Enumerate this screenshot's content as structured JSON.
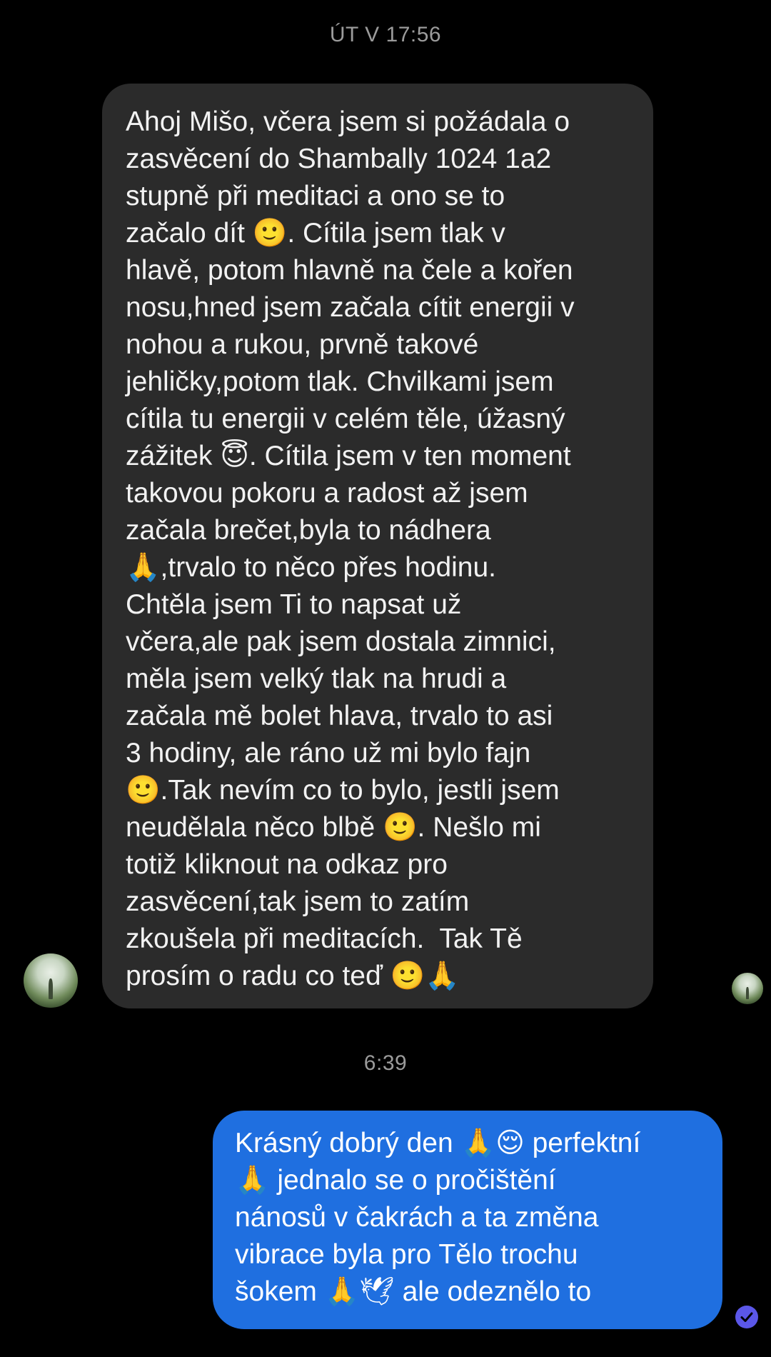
{
  "timestamps": {
    "first": "ÚT V 17:56",
    "second": "6:39"
  },
  "messages": {
    "incoming": {
      "text": "Ahoj Mišo, včera jsem si požádala o\nzasvěcení do Shambally 1024 1a2\nstupně při meditaci a ono se to\nzačalo dít 🙂. Cítila jsem tlak v\nhlavě, potom hlavně na čele a kořen\nnosu,hned jsem začala cítit energii v\nnohou a rukou, prvně takové\njehličky,potom tlak. Chvilkami jsem\ncítila tu energii v celém těle, úžasný\nzážitek 😇. Cítila jsem v ten moment\ntakovou pokoru a radost až jsem\nzačala brečet,byla to nádhera\n🙏,trvalo to něco přes hodinu.\nChtěla jsem Ti to napsat už\nvčera,ale pak jsem dostala zimnici,\nměla jsem velký tlak na hrudi a\nzačala mě bolet hlava, trvalo to asi\n3 hodiny, ale ráno už mi bylo fajn\n🙂.Tak nevím co to bylo, jestli jsem\nneudělala něco blbě 🙂. Nešlo mi\ntotiž kliknout na odkaz pro\nzasvěcení,tak jsem to zatím\nzkoušela při meditacích.  Tak Tě\nprosím o radu co teď 🙂🙏"
    },
    "outgoing": {
      "text": "Krásný dobrý den 🙏😌 perfektní\n🙏 jednalo se o pročištění\nnánosů v čakrách a ta změna\nvibrace byla pro Tělo trochu\nšokem 🙏🕊 ale odeznělo to"
    }
  },
  "avatars": {
    "contact": "contact-avatar",
    "seen": "seen-avatar"
  },
  "status": {
    "icon": "check-circle-icon"
  },
  "colors": {
    "background": "#000000",
    "incoming_bubble": "#2b2b2b",
    "outgoing_bubble": "#1f6fe0",
    "timestamp": "#9b9b9b",
    "delivered": "#5b57e8"
  }
}
